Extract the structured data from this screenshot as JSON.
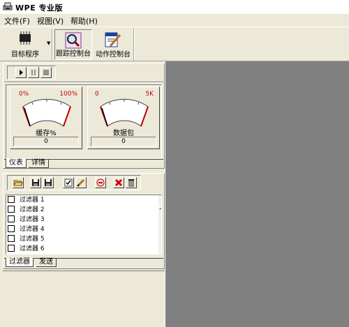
{
  "window": {
    "title": "WPE 专业版"
  },
  "menu": [
    {
      "label": "文件(F)"
    },
    {
      "label": "视图(V)"
    },
    {
      "label": "帮助(H)"
    }
  ],
  "toolbar": {
    "target_label": "目标程序",
    "trace_label": "跟踪控制台",
    "action_label": "动作控制台"
  },
  "gauges": [
    {
      "min": "0%",
      "max": "100%",
      "caption": "缓存%",
      "value": "0",
      "needle": 0
    },
    {
      "min": "0",
      "max": "5K",
      "caption": "数据包",
      "value": "0",
      "needle": 0
    }
  ],
  "monitor_tabs": [
    {
      "label": "仪表"
    },
    {
      "label": "详情"
    }
  ],
  "filters": [
    {
      "label": "过滤器 1",
      "checked": false
    },
    {
      "label": "过滤器 2",
      "checked": false
    },
    {
      "label": "过滤器 3",
      "checked": false
    },
    {
      "label": "过滤器 4",
      "checked": false
    },
    {
      "label": "过滤器 5",
      "checked": false
    },
    {
      "label": "过滤器 6",
      "checked": false
    }
  ],
  "bottom_tabs": [
    {
      "label": "过滤器"
    },
    {
      "label": "发送"
    }
  ],
  "colors": {
    "workspace": "#808080",
    "gauge_red": "#c00000",
    "window_bg": "#ece9d8"
  }
}
